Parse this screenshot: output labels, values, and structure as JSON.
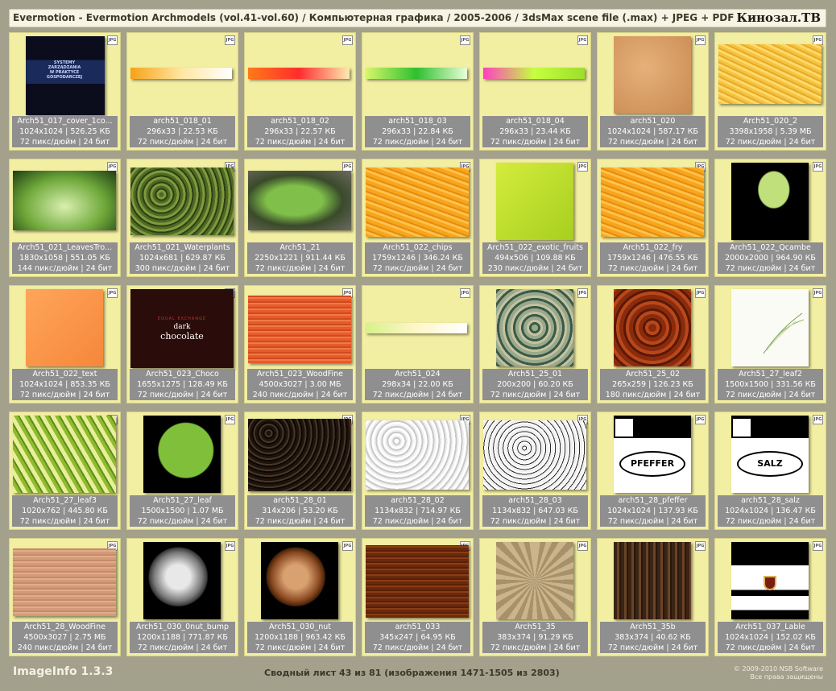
{
  "header": {
    "title": "Evermotion - Evermotion Archmodels (vol.41-vol.60) / Компьютерная графика / 2005-2006 / 3dsMax scene file (.max) + JPEG + PDF",
    "brand": "Кинозал.ТВ"
  },
  "badge_label": "JPG",
  "items": [
    {
      "name": "Arch51_017_cover_1co...",
      "size": "1024x1024 | 526.25 КБ",
      "meta": "72 пикс/дюйм | 24 бит",
      "thumb": "book-cover"
    },
    {
      "name": "arch51_018_01",
      "size": "296x33 | 22.53 КБ",
      "meta": "72 пикс/дюйм | 24 бит",
      "thumb": "strip-orange"
    },
    {
      "name": "arch51_018_02",
      "size": "296x33 | 22.57 КБ",
      "meta": "72 пикс/дюйм | 24 бит",
      "thumb": "strip-red"
    },
    {
      "name": "arch51_018_03",
      "size": "296x33 | 22.84 КБ",
      "meta": "72 пикс/дюйм | 24 бит",
      "thumb": "strip-green"
    },
    {
      "name": "arch51_018_04",
      "size": "296x33 | 23.44 КБ",
      "meta": "72 пикс/дюйм | 24 бит",
      "thumb": "strip-magenta"
    },
    {
      "name": "arch51_020",
      "size": "1024x1024 | 587.17 КБ",
      "meta": "72 пикс/дюйм | 24 бит",
      "thumb": "sand"
    },
    {
      "name": "Arch51_020_2",
      "size": "3398x1958 | 5.39 МБ",
      "meta": "72 пикс/дюйм | 24 бит",
      "thumb": "yellow-grain"
    },
    {
      "name": "Arch51_021_LeavesTro...",
      "size": "1830x1058 | 551.05 КБ",
      "meta": "144 пикс/дюйм | 24 бит",
      "thumb": "leaf-tropical"
    },
    {
      "name": "Arch51_021_Waterplants",
      "size": "1024x681 | 629.87 КБ",
      "meta": "300 пикс/дюйм | 24 бит",
      "thumb": "moss"
    },
    {
      "name": "Arch51_21",
      "size": "2250x1221 | 911.44 КБ",
      "meta": "72 пикс/дюйм | 24 бит",
      "thumb": "leaf-photo"
    },
    {
      "name": "Arch51_022_chips",
      "size": "1759x1246 | 346.24 КБ",
      "meta": "72 пикс/дюйм | 24 бит",
      "thumb": "orange-grain"
    },
    {
      "name": "Arch51_022_exotic_fruits",
      "size": "494x506 | 109.88 КБ",
      "meta": "230 пикс/дюйм | 24 бит",
      "thumb": "lime"
    },
    {
      "name": "Arch51_022_fry",
      "size": "1759x1246 | 476.55 КБ",
      "meta": "72 пикс/дюйм | 24 бит",
      "thumb": "orange-grain"
    },
    {
      "name": "Arch51_022_Qcambe",
      "size": "2000x2000 | 964.90 КБ",
      "meta": "72 пикс/дюйм | 24 бит",
      "thumb": "cucumber"
    },
    {
      "name": "Arch51_022_text",
      "size": "1024x1024 | 853.35 КБ",
      "meta": "72 пикс/дюйм | 24 бит",
      "thumb": "orange-flat"
    },
    {
      "name": "Arch51_023_Choco",
      "size": "1655x1275 | 128.49 КБ",
      "meta": "72 пикс/дюйм | 24 бит",
      "thumb": "chocolate",
      "thumb_small": "EQUAL EXCHANGE",
      "thumb_line1": "dark",
      "thumb_line2": "chocolate"
    },
    {
      "name": "Arch51_023_WoodFine",
      "size": "4500x3027 | 3.00 МБ",
      "meta": "240 пикс/дюйм | 24 бит",
      "thumb": "wood-orange"
    },
    {
      "name": "Arch51_024",
      "size": "298x34 | 22.00 КБ",
      "meta": "72 пикс/дюйм | 24 бит",
      "thumb": "strip-pale"
    },
    {
      "name": "Arch51_25_01",
      "size": "200x200 | 60.20 КБ",
      "meta": "72 пикс/дюйм | 24 бит",
      "thumb": "marble-green"
    },
    {
      "name": "Arch51_25_02",
      "size": "265x259 | 126.23 КБ",
      "meta": "180 пикс/дюйм | 24 бит",
      "thumb": "rust"
    },
    {
      "name": "Arch51_27_leaf2",
      "size": "1500x1500 | 331.56 КБ",
      "meta": "72 пикс/дюйм | 24 бит",
      "thumb": "white-leaf"
    },
    {
      "name": "Arch51_27_leaf3",
      "size": "1020x762 | 445.80 КБ",
      "meta": "72 пикс/дюйм | 24 бит",
      "thumb": "leaf-veins"
    },
    {
      "name": "Arch51_27_leaf",
      "size": "1500x1500 | 1.07 МБ",
      "meta": "72 пикс/дюйм | 24 бит",
      "thumb": "banana-leaf"
    },
    {
      "name": "arch51_28_01",
      "size": "314x206 | 53.20 КБ",
      "meta": "72 пикс/дюйм | 24 бит",
      "thumb": "pepper"
    },
    {
      "name": "arch51_28_02",
      "size": "1134x832 | 714.97 КБ",
      "meta": "72 пикс/дюйм | 24 бит",
      "thumb": "pattern-light"
    },
    {
      "name": "arch51_28_03",
      "size": "1134x832 | 647.03 КБ",
      "meta": "72 пикс/дюйм | 24 бит",
      "thumb": "pattern-dark"
    },
    {
      "name": "arch51_28_pfeffer",
      "size": "1024x1024 | 137.93 КБ",
      "meta": "72 пикс/дюйм | 24 бит",
      "thumb": "label-oval",
      "thumb_text": "PFEFFER"
    },
    {
      "name": "arch51_28_salz",
      "size": "1024x1024 | 136.47 КБ",
      "meta": "72 пикс/дюйм | 24 бит",
      "thumb": "label-oval",
      "thumb_text": "SALZ"
    },
    {
      "name": "Arch51_28_WoodFine",
      "size": "4500x3027 | 2.75 МБ",
      "meta": "240 пикс/дюйм | 24 бит",
      "thumb": "wood-pink"
    },
    {
      "name": "Arch51_030_0nut_bump",
      "size": "1200x1188 | 771.87 КБ",
      "meta": "72 пикс/дюйм | 24 бит",
      "thumb": "nut-gray"
    },
    {
      "name": "Arch51_030_nut",
      "size": "1200x1188 | 963.42 КБ",
      "meta": "72 пикс/дюйм | 24 бит",
      "thumb": "nut-brown"
    },
    {
      "name": "arch51_033",
      "size": "345x247 | 64.95 КБ",
      "meta": "72 пикс/дюйм | 24 бит",
      "thumb": "wood-brown"
    },
    {
      "name": "Arch51_35",
      "size": "383x374 | 91.29 КБ",
      "meta": "72 пикс/дюйм | 24 бит",
      "thumb": "radial"
    },
    {
      "name": "Arch51_35b",
      "size": "383x374 | 40.62 КБ",
      "meta": "72 пикс/дюйм | 24 бит",
      "thumb": "dark-wood"
    },
    {
      "name": "Arch51_037_Lable",
      "size": "1024x1024 | 152.02 КБ",
      "meta": "72 пикс/дюйм | 24 бит",
      "thumb": "lable-crest"
    }
  ],
  "book_cover": {
    "l1": "SYSTEMY",
    "l2": "ZARZĄDZANIA",
    "l3": "W PRAKTYCE",
    "l4": "GOSPODARCZEJ"
  },
  "footer": {
    "app": "ImageInfo 1.3.3",
    "summary": "Сводный лист 43 из 81 (изображения 1471-1505 из 2803)",
    "copyright": "© 2009-2010 NSB Software",
    "rights": "Все права защищены"
  }
}
